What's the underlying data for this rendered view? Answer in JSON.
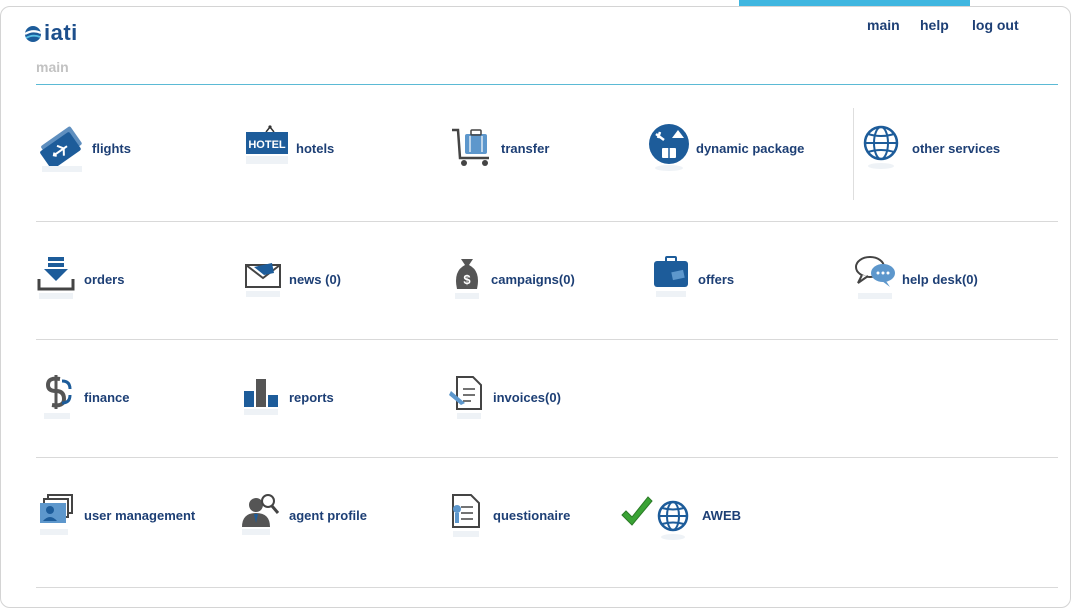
{
  "brand": {
    "logo_text": "iati"
  },
  "nav": {
    "main": "main",
    "help": "help",
    "logout": "log out"
  },
  "page": {
    "title": "main"
  },
  "tiles": {
    "flights": "flights",
    "hotels": "hotels",
    "transfer": "transfer",
    "dynamic_package": "dynamic package",
    "other_services": "other services",
    "orders": "orders",
    "news": "news (0)",
    "campaigns": "campaigns(0)",
    "offers": "offers",
    "help_desk": "help desk(0)",
    "finance": "finance",
    "reports": "reports",
    "invoices": "invoices(0)",
    "user_management": "user management",
    "agent_profile": "agent profile",
    "questionaire": "questionaire",
    "aweb": "AWEB"
  },
  "icons": {
    "flights": "plane-ticket-icon",
    "hotels": "hotel-sign-icon",
    "transfer": "luggage-cart-icon",
    "dynamic_package": "package-globe-icon",
    "other_services": "globe-icon",
    "orders": "download-tray-icon",
    "news": "envelope-icon",
    "campaigns": "money-bag-icon",
    "offers": "suitcase-icon",
    "help_desk": "speech-bubbles-icon",
    "finance": "dollar-sign-icon",
    "reports": "bar-chart-icon",
    "invoices": "document-pen-icon",
    "user_management": "user-cards-icon",
    "agent_profile": "agent-search-icon",
    "questionaire": "questionnaire-document-icon",
    "aweb": "checkmark-globe-icon"
  },
  "colors": {
    "accent": "#3fb6e0",
    "link": "#1d3f75",
    "icon_blue": "#1d5c9a"
  }
}
